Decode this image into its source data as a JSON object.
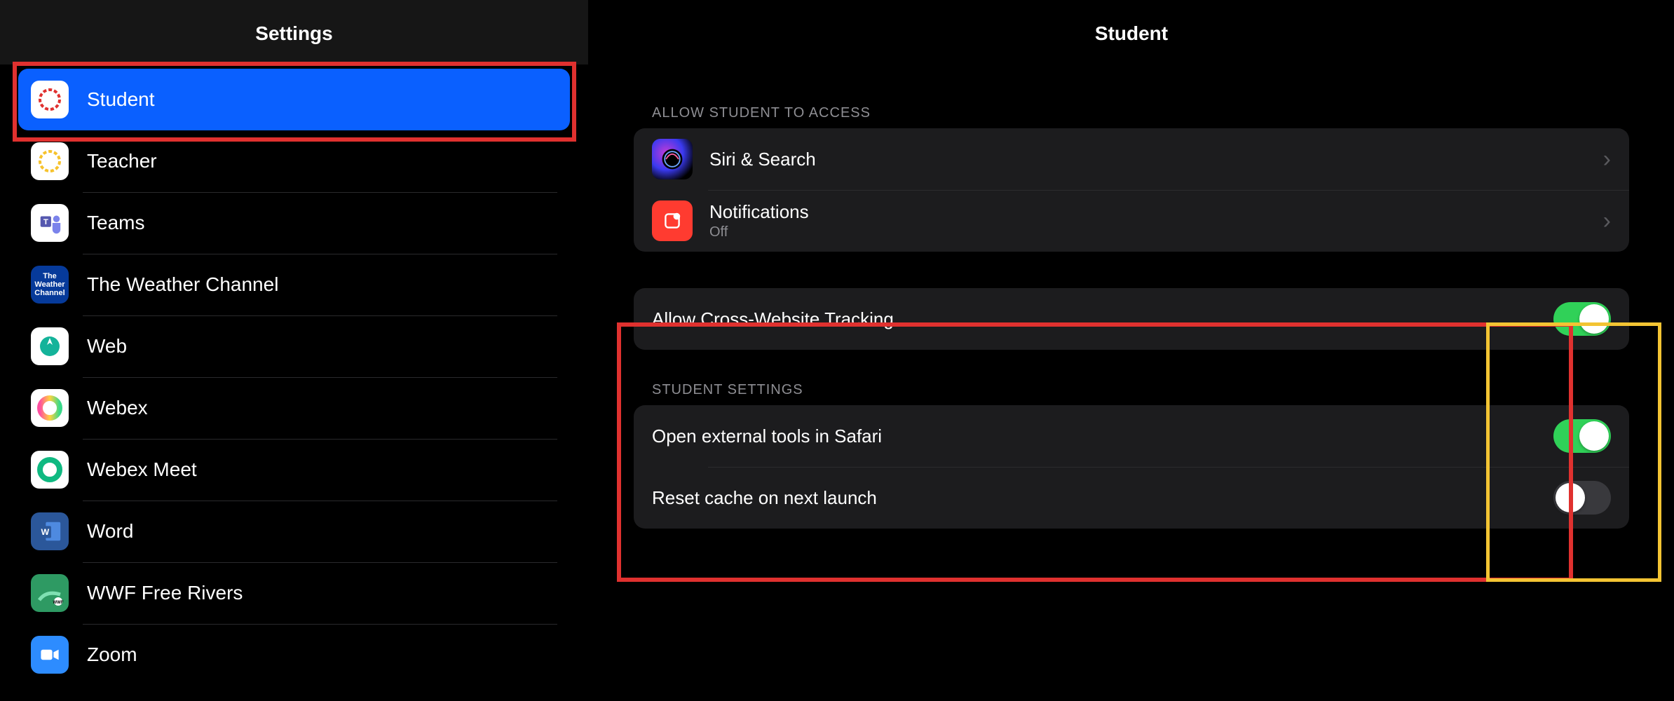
{
  "sidebar": {
    "title": "Settings",
    "items": [
      {
        "label": "Student",
        "icon": "canvas-student-icon",
        "selected": true
      },
      {
        "label": "Teacher",
        "icon": "canvas-teacher-icon",
        "selected": false
      },
      {
        "label": "Teams",
        "icon": "teams-icon",
        "selected": false
      },
      {
        "label": "The Weather Channel",
        "icon": "weather-channel-icon",
        "selected": false
      },
      {
        "label": "Web",
        "icon": "web-icon",
        "selected": false
      },
      {
        "label": "Webex",
        "icon": "webex-icon",
        "selected": false
      },
      {
        "label": "Webex Meet",
        "icon": "webex-meet-icon",
        "selected": false
      },
      {
        "label": "Word",
        "icon": "word-icon",
        "selected": false
      },
      {
        "label": "WWF Free Rivers",
        "icon": "wwf-icon",
        "selected": false
      },
      {
        "label": "Zoom",
        "icon": "zoom-icon",
        "selected": false
      }
    ]
  },
  "detail": {
    "title": "Student",
    "access_group_label": "Allow Student to Access",
    "access_rows": {
      "siri": {
        "title": "Siri & Search"
      },
      "notifications": {
        "title": "Notifications",
        "sub": "Off"
      }
    },
    "tracking": {
      "label": "Allow Cross-Website Tracking",
      "on": true
    },
    "settings_group_label": "Student Settings",
    "settings_rows": {
      "open_safari": {
        "label": "Open external tools in Safari",
        "on": true
      },
      "reset_cache": {
        "label": "Reset cache on next launch",
        "on": false
      }
    }
  },
  "annotations": {
    "sidebar_highlight": "red",
    "detail_highlight": "red",
    "toggle_highlight": "yellow"
  }
}
